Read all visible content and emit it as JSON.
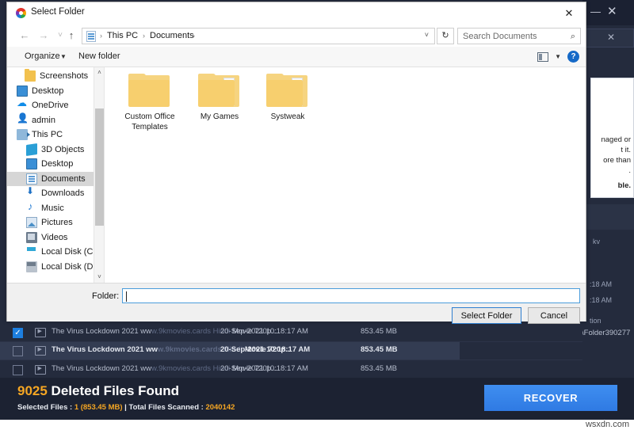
{
  "background_app": {
    "window_controls": {
      "minimize": "—",
      "close": "✕",
      "sub_close": "✕"
    },
    "info_popup": {
      "lines": [
        "naged or",
        "t it.",
        "ore than",
        ".",
        "ble."
      ]
    },
    "right_column": {
      "kv": "kv",
      "time1": ":18 AM",
      "time2": ":18 AM",
      "tion": "tion",
      "folder_path": "\\Folder390277"
    },
    "file_rows": [
      {
        "checked": true,
        "name_start": "The Virus Lockdown 2021 ww",
        "name_dim": "w.9kmovies.cards Hindi",
        "name_end": " Movie 720p...",
        "date": "20-Sep-2021 10:18:17 AM",
        "size": "853.45 MB"
      },
      {
        "checked": false,
        "name_start": "The Virus Lockdown 2021 ww",
        "name_dim": "w.9kmovies.cards Hindi",
        "name_end": " Movie 720p...",
        "date": "20-Sep-2021 10:18:17 AM",
        "size": "853.45 MB"
      },
      {
        "checked": false,
        "name_start": "The Virus Lockdown 2021 ww",
        "name_dim": "w.9kmovies.cards Hindi",
        "name_end": " Movie 720p...",
        "date": "20-Sep-2021 10:18:17 AM",
        "size": "853.45 MB"
      }
    ],
    "status": {
      "count": "9025",
      "headline": " Deleted Files Found",
      "sub_prefix": "Selected Files : ",
      "sub_selected": "1 (853.45 MB)",
      "sub_middle": " | Total Files Scanned : ",
      "sub_scanned": "2040142",
      "recover_label": "RECOVER",
      "accent_color": "#f5a623",
      "recover_color": "#3f8ef0"
    },
    "watermark": "wsxdn.com"
  },
  "dialog": {
    "title": "Select Folder",
    "close_label": "✕",
    "nav": {
      "back": "←",
      "forward": "→",
      "recent": "˅",
      "up": "↑",
      "breadcrumb": [
        "This PC",
        "Documents"
      ],
      "separator": "›",
      "dropdown_caret": "˅",
      "refresh": "↻"
    },
    "search": {
      "placeholder": "Search Documents",
      "icon": "⌕"
    },
    "toolbar": {
      "organize": "Organize",
      "organize_caret": "▼",
      "new_folder": "New folder",
      "view_caret": "▼",
      "help": "?"
    },
    "tree": [
      {
        "label": "Screenshots",
        "icon": "folder",
        "indent": 22,
        "selected": false
      },
      {
        "label": "Desktop",
        "icon": "monitor",
        "indent": 12,
        "selected": false
      },
      {
        "label": "OneDrive",
        "icon": "cloud",
        "indent": 12,
        "selected": false
      },
      {
        "label": "admin",
        "icon": "user",
        "indent": 12,
        "selected": false
      },
      {
        "label": "This PC",
        "icon": "pc",
        "indent": 12,
        "selected": false
      },
      {
        "label": "3D Objects",
        "icon": "3d",
        "indent": 24,
        "selected": false
      },
      {
        "label": "Desktop",
        "icon": "monitor",
        "indent": 24,
        "selected": false
      },
      {
        "label": "Documents",
        "icon": "doc",
        "indent": 24,
        "selected": true
      },
      {
        "label": "Downloads",
        "icon": "dl",
        "indent": 24,
        "selected": false
      },
      {
        "label": "Music",
        "icon": "music",
        "indent": 24,
        "selected": false
      },
      {
        "label": "Pictures",
        "icon": "pic",
        "indent": 24,
        "selected": false
      },
      {
        "label": "Videos",
        "icon": "vid",
        "indent": 24,
        "selected": false
      },
      {
        "label": "Local Disk (C:)",
        "icon": "diskc",
        "indent": 24,
        "selected": false
      },
      {
        "label": "Local Disk (D:)",
        "icon": "disk",
        "indent": 24,
        "selected": false
      }
    ],
    "scroll": {
      "up": "˄",
      "down": "˅"
    },
    "folders": [
      {
        "name": "Custom Office\nTemplates",
        "type": "plain"
      },
      {
        "name": "My Games",
        "type": "docs"
      },
      {
        "name": "Systweak",
        "type": "docs"
      }
    ],
    "footer": {
      "folder_label": "Folder:",
      "folder_value": "",
      "select_label": "Select Folder",
      "cancel_label": "Cancel"
    }
  }
}
